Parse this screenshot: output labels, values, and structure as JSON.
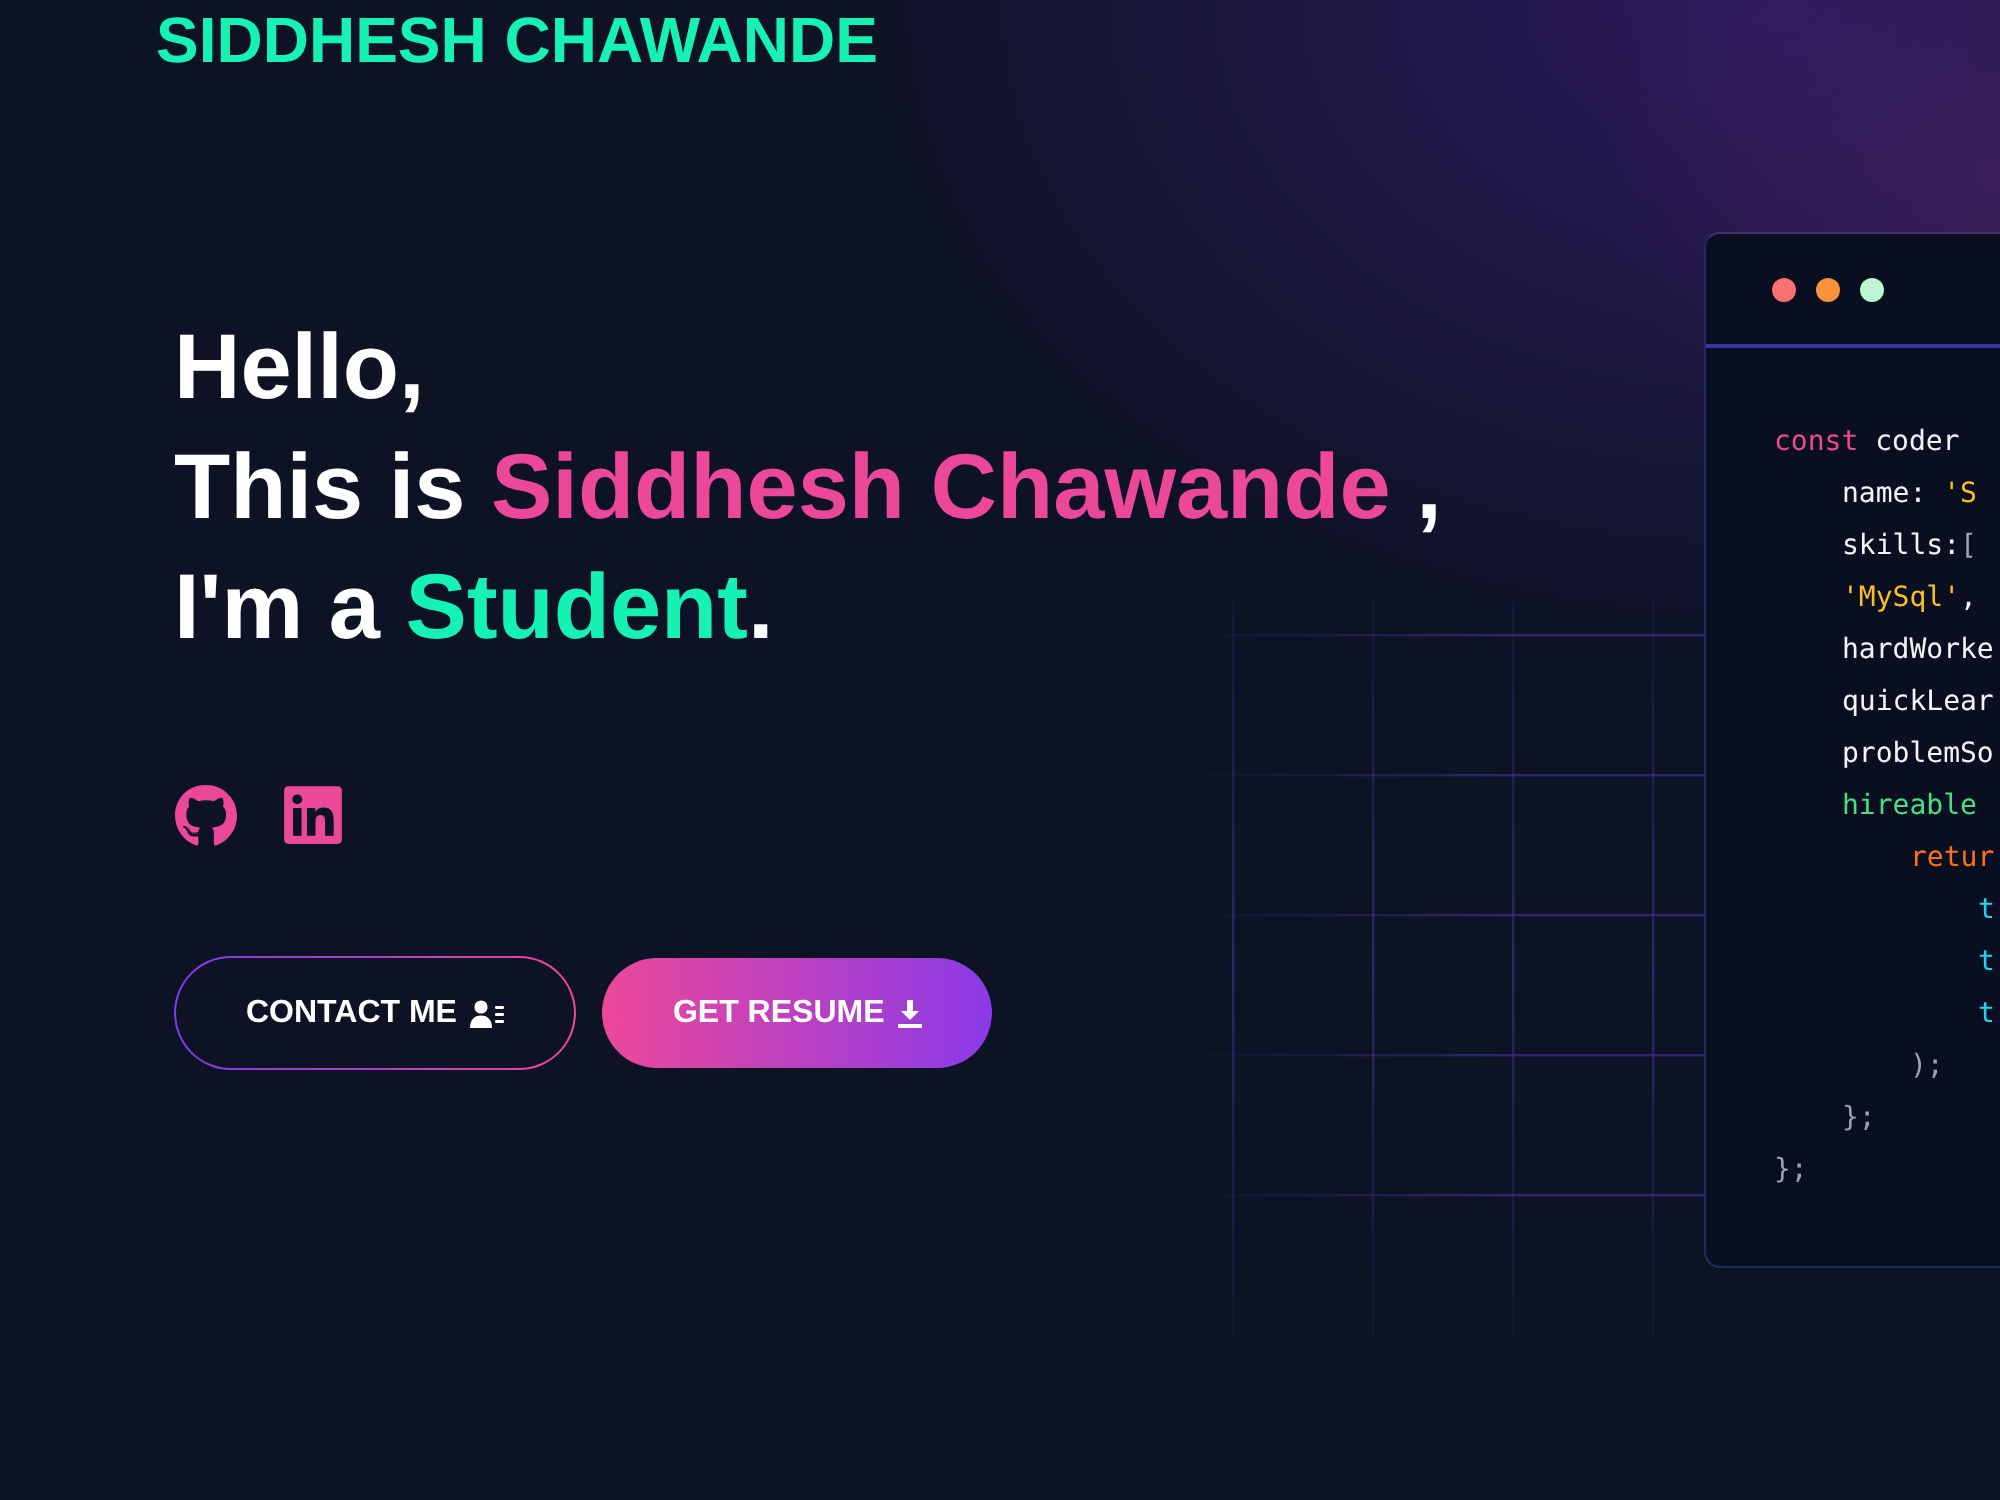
{
  "header": {
    "brand": "SIDDHESH CHAWANDE"
  },
  "hero": {
    "heading_lines": [
      {
        "parts": [
          {
            "text": "Hello,",
            "kind": "plain"
          }
        ]
      },
      {
        "parts": [
          {
            "text": "This is ",
            "kind": "plain"
          },
          {
            "text": "Siddhesh Chawande",
            "kind": "name"
          },
          {
            "text": " ,",
            "kind": "plain"
          }
        ]
      },
      {
        "parts": [
          {
            "text": "I'm a ",
            "kind": "plain"
          },
          {
            "text": "Student",
            "kind": "role"
          },
          {
            "text": ".",
            "kind": "plain"
          }
        ]
      }
    ],
    "buttons": [
      {
        "label": "CONTACT ME",
        "kind": "outline"
      },
      {
        "label": "GET RESUME",
        "kind": "filled"
      }
    ]
  },
  "code_window": {
    "dots": [
      {
        "color": "#f87171"
      },
      {
        "color": "#fb923c"
      },
      {
        "color": "#bbf7d0"
      }
    ],
    "lines": [
      {
        "tokens": [
          {
            "text": "const",
            "kind": "keyword"
          },
          {
            "text": " coder",
            "kind": "plain"
          }
        ],
        "children": [
          {
            "tokens": [
              {
                "text": "name: ",
                "kind": "plain"
              },
              {
                "text": "'S",
                "kind": "string"
              }
            ]
          },
          {
            "tokens": [
              {
                "text": "skills:",
                "kind": "plain"
              },
              {
                "text": "[",
                "kind": "punct"
              }
            ]
          },
          {
            "tokens": [
              {
                "text": "'MySql'",
                "kind": "string"
              },
              {
                "text": ",",
                "kind": "plain"
              }
            ]
          },
          {
            "tokens": [
              {
                "text": "hardWorke",
                "kind": "plain"
              }
            ]
          },
          {
            "tokens": [
              {
                "text": "quickLear",
                "kind": "plain"
              }
            ]
          },
          {
            "tokens": [
              {
                "text": "problemSo",
                "kind": "plain"
              }
            ]
          },
          {
            "tokens": [
              {
                "text": "hireable",
                "kind": "function"
              }
            ],
            "children": [
              {
                "tokens": [
                  {
                    "text": "retur",
                    "kind": "return"
                  }
                ],
                "children": [
                  {
                    "tokens": [
                      {
                        "text": "t",
                        "kind": "call"
                      }
                    ]
                  },
                  {
                    "tokens": [
                      {
                        "text": "t",
                        "kind": "call"
                      }
                    ]
                  },
                  {
                    "tokens": [
                      {
                        "text": "t",
                        "kind": "call"
                      }
                    ]
                  }
                ]
              },
              {
                "tokens": [
                  {
                    "text": ");",
                    "kind": "punct"
                  }
                ]
              }
            ]
          },
          {
            "tokens": [
              {
                "text": "};",
                "kind": "punct"
              }
            ]
          }
        ]
      },
      {
        "tokens": [
          {
            "text": "};",
            "kind": "punct"
          }
        ]
      }
    ]
  }
}
